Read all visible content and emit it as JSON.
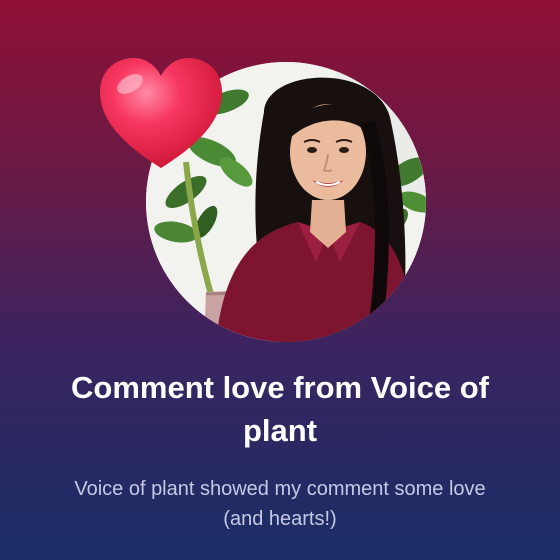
{
  "notification": {
    "title": "Comment love from Voice of plant",
    "subtitle": "Voice of plant showed my comment some love (and hearts!)",
    "avatar": "profile-photo",
    "badge_icon": "heart-icon"
  },
  "colors": {
    "background_top": "#8e0f35",
    "background_bottom": "#1a2e66",
    "heart": "#f0204a",
    "title_text": "#ffffff",
    "subtitle_text": "#c6c9e4"
  }
}
